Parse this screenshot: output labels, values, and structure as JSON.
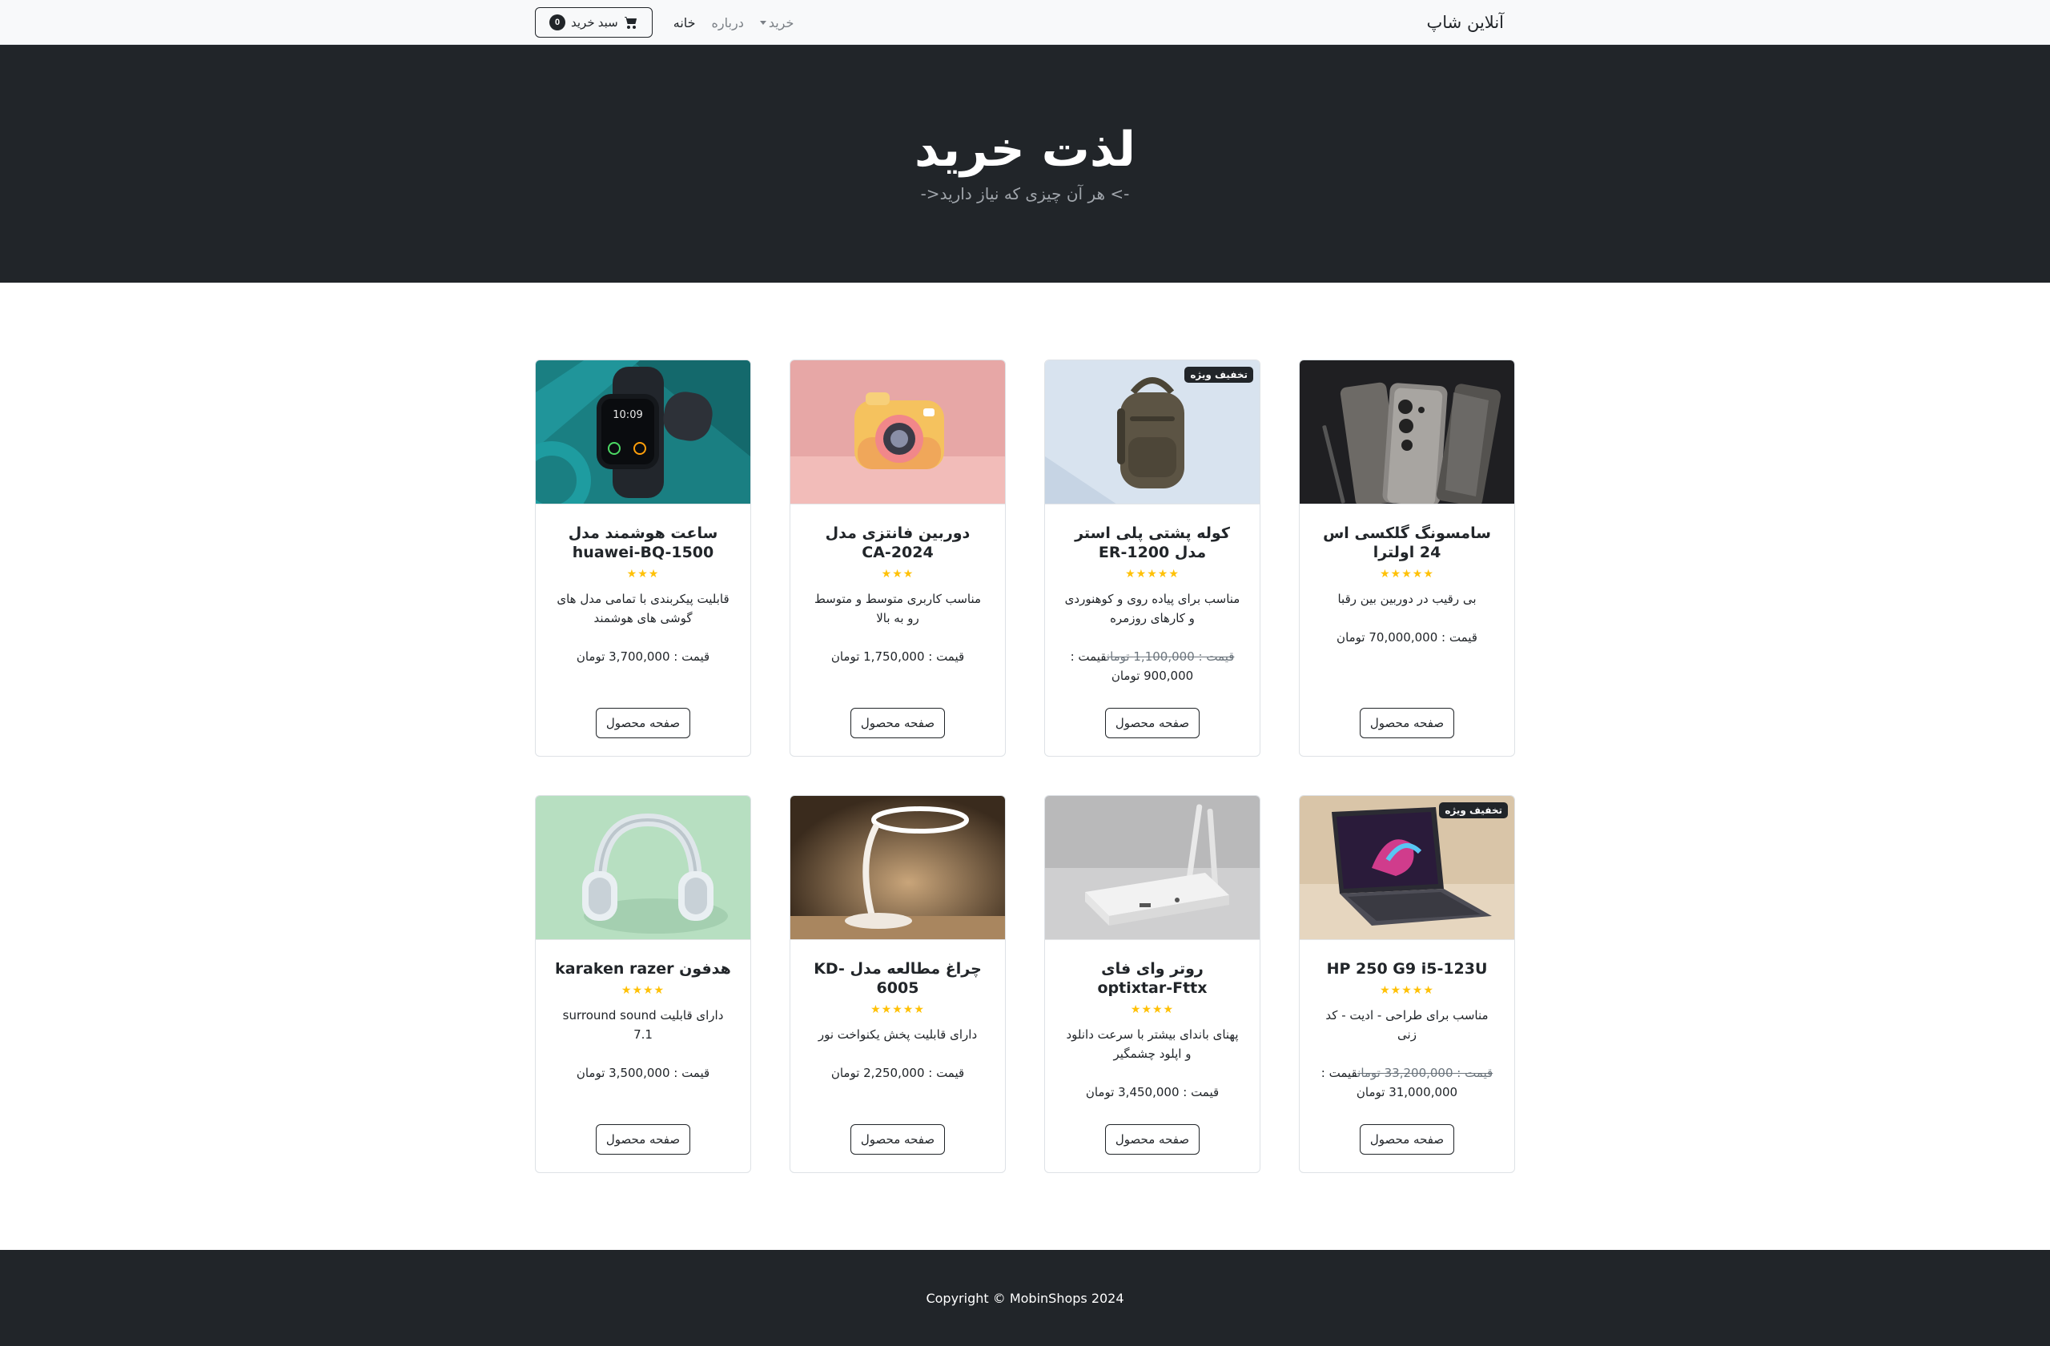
{
  "nav": {
    "brand": "آنلاین شاپ",
    "links": [
      {
        "label": "خانه",
        "active": true
      },
      {
        "label": "درباره",
        "active": false
      },
      {
        "label": "خرید",
        "active": false,
        "dropdown": true
      }
    ],
    "cart_label": "سبد خرید",
    "cart_count": "0"
  },
  "header": {
    "title": "لذت خرید",
    "subtitle": "-> هر آن چیزی که نیاز دارید<-"
  },
  "colors": {
    "dark": "#212529",
    "star": "#ffc107",
    "navbar_bg": "#f8f9fa"
  },
  "products": [
    {
      "title": "سامسونگ گلکسی اس 24 اولترا",
      "stars": "★★★★★",
      "rating": 5,
      "desc": "بی رقیب در دوربین بین رقبا",
      "price": "قیمت : 70,000,000 تومان",
      "old_price": "",
      "sale_badge": "",
      "button": "صفحه محصول",
      "image": "samsung-phone-image"
    },
    {
      "title": "کوله پشتی پلی استر مدل ER-1200",
      "stars": "★★★★★",
      "rating": 5,
      "desc": "مناسب برای پیاده روی و کوهنوردی و کارهای روزمره",
      "old_price": "قیمت : 1,100,000 تومان",
      "price": "قیمت : 900,000 تومان",
      "sale_badge": "تخفیف ویژه",
      "button": "صفحه محصول",
      "image": "backpack-image"
    },
    {
      "title": "دوربین فانتزی مدل CA-2024",
      "stars": "★★★",
      "rating": 3,
      "desc": "مناسب کاربری متوسط و متوسط رو به بالا",
      "price": "قیمت : 1,750,000 تومان",
      "old_price": "",
      "sale_badge": "",
      "button": "صفحه محصول",
      "image": "toy-camera-image"
    },
    {
      "title": "ساعت هوشمند مدل huawei-BQ-1500",
      "stars": "★★★",
      "rating": 3,
      "desc": "قابلیت پیکربندی با تمامی مدل های گوشی های هوشمند",
      "price": "قیمت : 3,700,000 تومان",
      "old_price": "",
      "sale_badge": "",
      "button": "صفحه محصول",
      "image": "smartwatch-image"
    },
    {
      "title": "HP 250 G9 i5-123U",
      "stars": "★★★★★",
      "rating": 5,
      "desc": "مناسب برای طراحی - ادیت - کد زنی",
      "old_price": "قیمت : 33,200,000 تومان",
      "price": "قیمت : 31,000,000 تومان",
      "sale_badge": "تخفیف ویژه",
      "button": "صفحه محصول",
      "image": "laptop-image"
    },
    {
      "title": "روتر وای فای optixtar-Fttx",
      "stars": "★★★★",
      "rating": 4,
      "desc": "پهنای باندای بیشتر با سرعت دانلود و اپلود چشمگیر",
      "price": "قیمت : 3,450,000 تومان",
      "old_price": "",
      "sale_badge": "",
      "button": "صفحه محصول",
      "image": "router-image"
    },
    {
      "title": "چراغ مطالعه مدل KD-6005",
      "stars": "★★★★★",
      "rating": 5,
      "desc": "دارای قابلیت پخش یکنواخت نور",
      "price": "قیمت : 2,250,000 تومان",
      "old_price": "",
      "sale_badge": "",
      "button": "صفحه محصول",
      "image": "desk-lamp-image"
    },
    {
      "title": "هدفون karaken razer",
      "stars": "★★★★",
      "rating": 4,
      "desc": "دارای قابلیت surround sound 7.1",
      "price": "قیمت : 3,500,000 تومان",
      "old_price": "",
      "sale_badge": "",
      "button": "صفحه محصول",
      "image": "headphones-image"
    }
  ],
  "footer": {
    "copyright": "Copyright © MobinShops 2024"
  }
}
